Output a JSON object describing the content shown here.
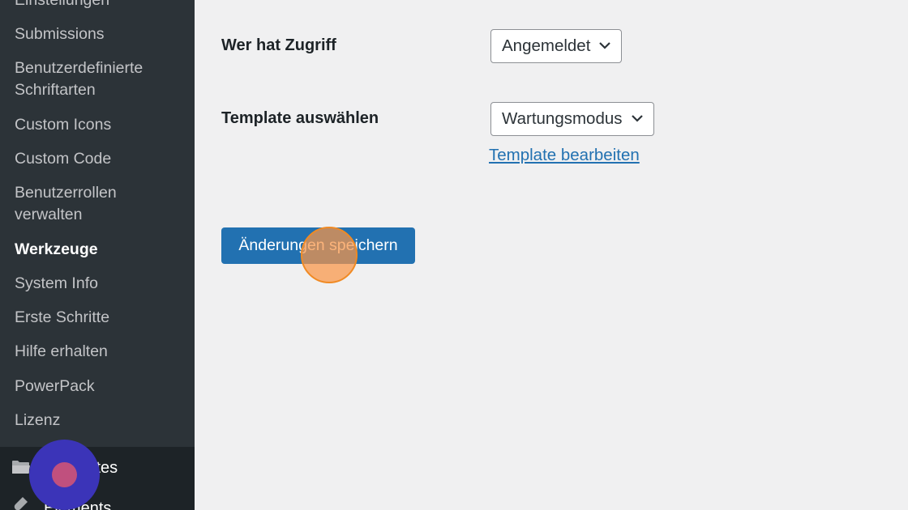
{
  "sidebar": {
    "items": [
      {
        "label": "Einstellungen",
        "active": false
      },
      {
        "label": "Submissions",
        "active": false
      },
      {
        "label": "Benutzerdefinierte Schriftarten",
        "active": false
      },
      {
        "label": "Custom Icons",
        "active": false
      },
      {
        "label": "Custom Code",
        "active": false
      },
      {
        "label": "Benutzerrollen verwalten",
        "active": false
      },
      {
        "label": "Werkzeuge",
        "active": true
      },
      {
        "label": "System Info",
        "active": false
      },
      {
        "label": "Erste Schritte",
        "active": false
      },
      {
        "label": "Hilfe erhalten",
        "active": false
      },
      {
        "label": "PowerPack",
        "active": false
      },
      {
        "label": "Lizenz",
        "active": false
      }
    ],
    "top_items": [
      {
        "label": "Templates",
        "icon": "folder-icon"
      },
      {
        "label": "Elements",
        "icon": "plug-icon"
      }
    ]
  },
  "main": {
    "access_label": "Wer hat Zugriff",
    "access_value": "Angemeldet",
    "template_label": "Template auswählen",
    "template_value": "Wartungsmodus",
    "edit_template_link": "Template bearbeiten",
    "save_button": "Änderungen speichern"
  },
  "colors": {
    "sidebar_bg": "#2c3338",
    "sidebar_lower_bg": "#1d2327",
    "primary": "#2271b1",
    "page_bg": "#f0f0f1",
    "click_marker": "#f08a24",
    "cursor_marker": "#3b34b8"
  }
}
